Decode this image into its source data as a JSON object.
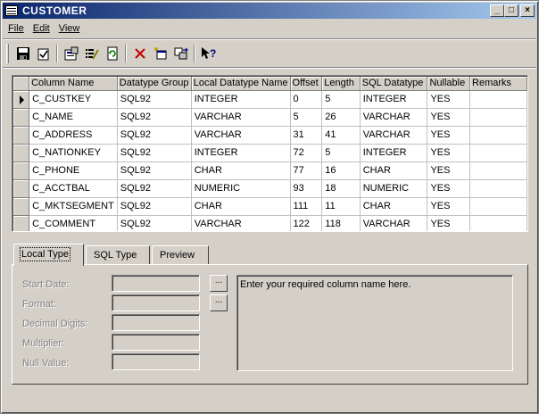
{
  "window": {
    "title": "CUSTOMER"
  },
  "titlebar_buttons": {
    "minimize": "_",
    "maximize": "□",
    "close": "×"
  },
  "menu": [
    "File",
    "Edit",
    "View"
  ],
  "toolbar": [
    "save-icon",
    "check-icon",
    "properties-icon",
    "edit-list-icon",
    "refresh-icon",
    "delete-icon",
    "new-window-icon",
    "move-icon",
    "help-icon"
  ],
  "grid": {
    "columns": [
      "Column Name",
      "Datatype Group",
      "Local Datatype Name",
      "Offset",
      "Length",
      "SQL Datatype",
      "Nullable",
      "Remarks"
    ],
    "rows": [
      [
        "C_CUSTKEY",
        "SQL92",
        "INTEGER",
        "0",
        "5",
        "INTEGER",
        "YES",
        ""
      ],
      [
        "C_NAME",
        "SQL92",
        "VARCHAR",
        "5",
        "26",
        "VARCHAR",
        "YES",
        ""
      ],
      [
        "C_ADDRESS",
        "SQL92",
        "VARCHAR",
        "31",
        "41",
        "VARCHAR",
        "YES",
        ""
      ],
      [
        "C_NATIONKEY",
        "SQL92",
        "INTEGER",
        "72",
        "5",
        "INTEGER",
        "YES",
        ""
      ],
      [
        "C_PHONE",
        "SQL92",
        "CHAR",
        "77",
        "16",
        "CHAR",
        "YES",
        ""
      ],
      [
        "C_ACCTBAL",
        "SQL92",
        "NUMERIC",
        "93",
        "18",
        "NUMERIC",
        "YES",
        ""
      ],
      [
        "C_MKTSEGMENT",
        "SQL92",
        "CHAR",
        "111",
        "11",
        "CHAR",
        "YES",
        ""
      ],
      [
        "C_COMMENT",
        "SQL92",
        "VARCHAR",
        "122",
        "118",
        "VARCHAR",
        "YES",
        ""
      ]
    ],
    "current_row": 0
  },
  "tabs": [
    {
      "label": "Local Type",
      "active": true
    },
    {
      "label": "SQL Type",
      "active": false
    },
    {
      "label": "Preview",
      "active": false
    }
  ],
  "fields": [
    {
      "label": "Start Date:",
      "value": "",
      "has_button": true
    },
    {
      "label": "Format:",
      "value": "",
      "has_button": true
    },
    {
      "label": "Decimal Digits:",
      "value": "",
      "has_button": false
    },
    {
      "label": "Multiplier:",
      "value": "",
      "has_button": false
    },
    {
      "label": "Null Value:",
      "value": "",
      "has_button": false
    }
  ],
  "ellipsis_label": "...",
  "description": "Enter your required column name here."
}
